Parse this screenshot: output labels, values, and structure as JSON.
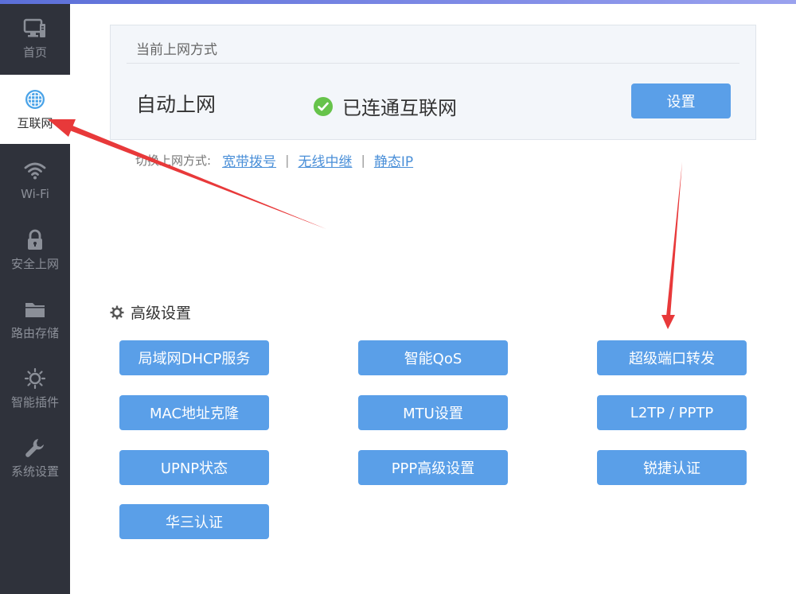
{
  "sidebar": {
    "items": [
      {
        "label": "首页",
        "icon": "monitor-icon"
      },
      {
        "label": "互联网",
        "icon": "globe-icon",
        "active": true
      },
      {
        "label": "Wi-Fi",
        "icon": "wifi-icon"
      },
      {
        "label": "安全上网",
        "icon": "lock-icon"
      },
      {
        "label": "路由存储",
        "icon": "folder-icon"
      },
      {
        "label": "智能插件",
        "icon": "sun-icon"
      },
      {
        "label": "系统设置",
        "icon": "wrench-icon"
      }
    ]
  },
  "internet": {
    "section_title": "当前上网方式",
    "mode": "自动上网",
    "status": "已连通互联网",
    "settings_button": "设置",
    "switch_prefix": "切换上网方式:",
    "switch_links": [
      "宽带拨号",
      "无线中继",
      "静态IP"
    ],
    "switch_separator": "|"
  },
  "advanced": {
    "title": "高级设置",
    "buttons": [
      "局域网DHCP服务",
      "智能QoS",
      "超级端口转发",
      "MAC地址克隆",
      "MTU设置",
      "L2TP / PPTP",
      "UPNP状态",
      "PPP高级设置",
      "锐捷认证",
      "华三认证"
    ]
  },
  "colors": {
    "sidebar_bg": "#2f323b",
    "accent": "#5a9fe8",
    "success": "#66c34a",
    "annotation_arrow": "#e8393a"
  }
}
